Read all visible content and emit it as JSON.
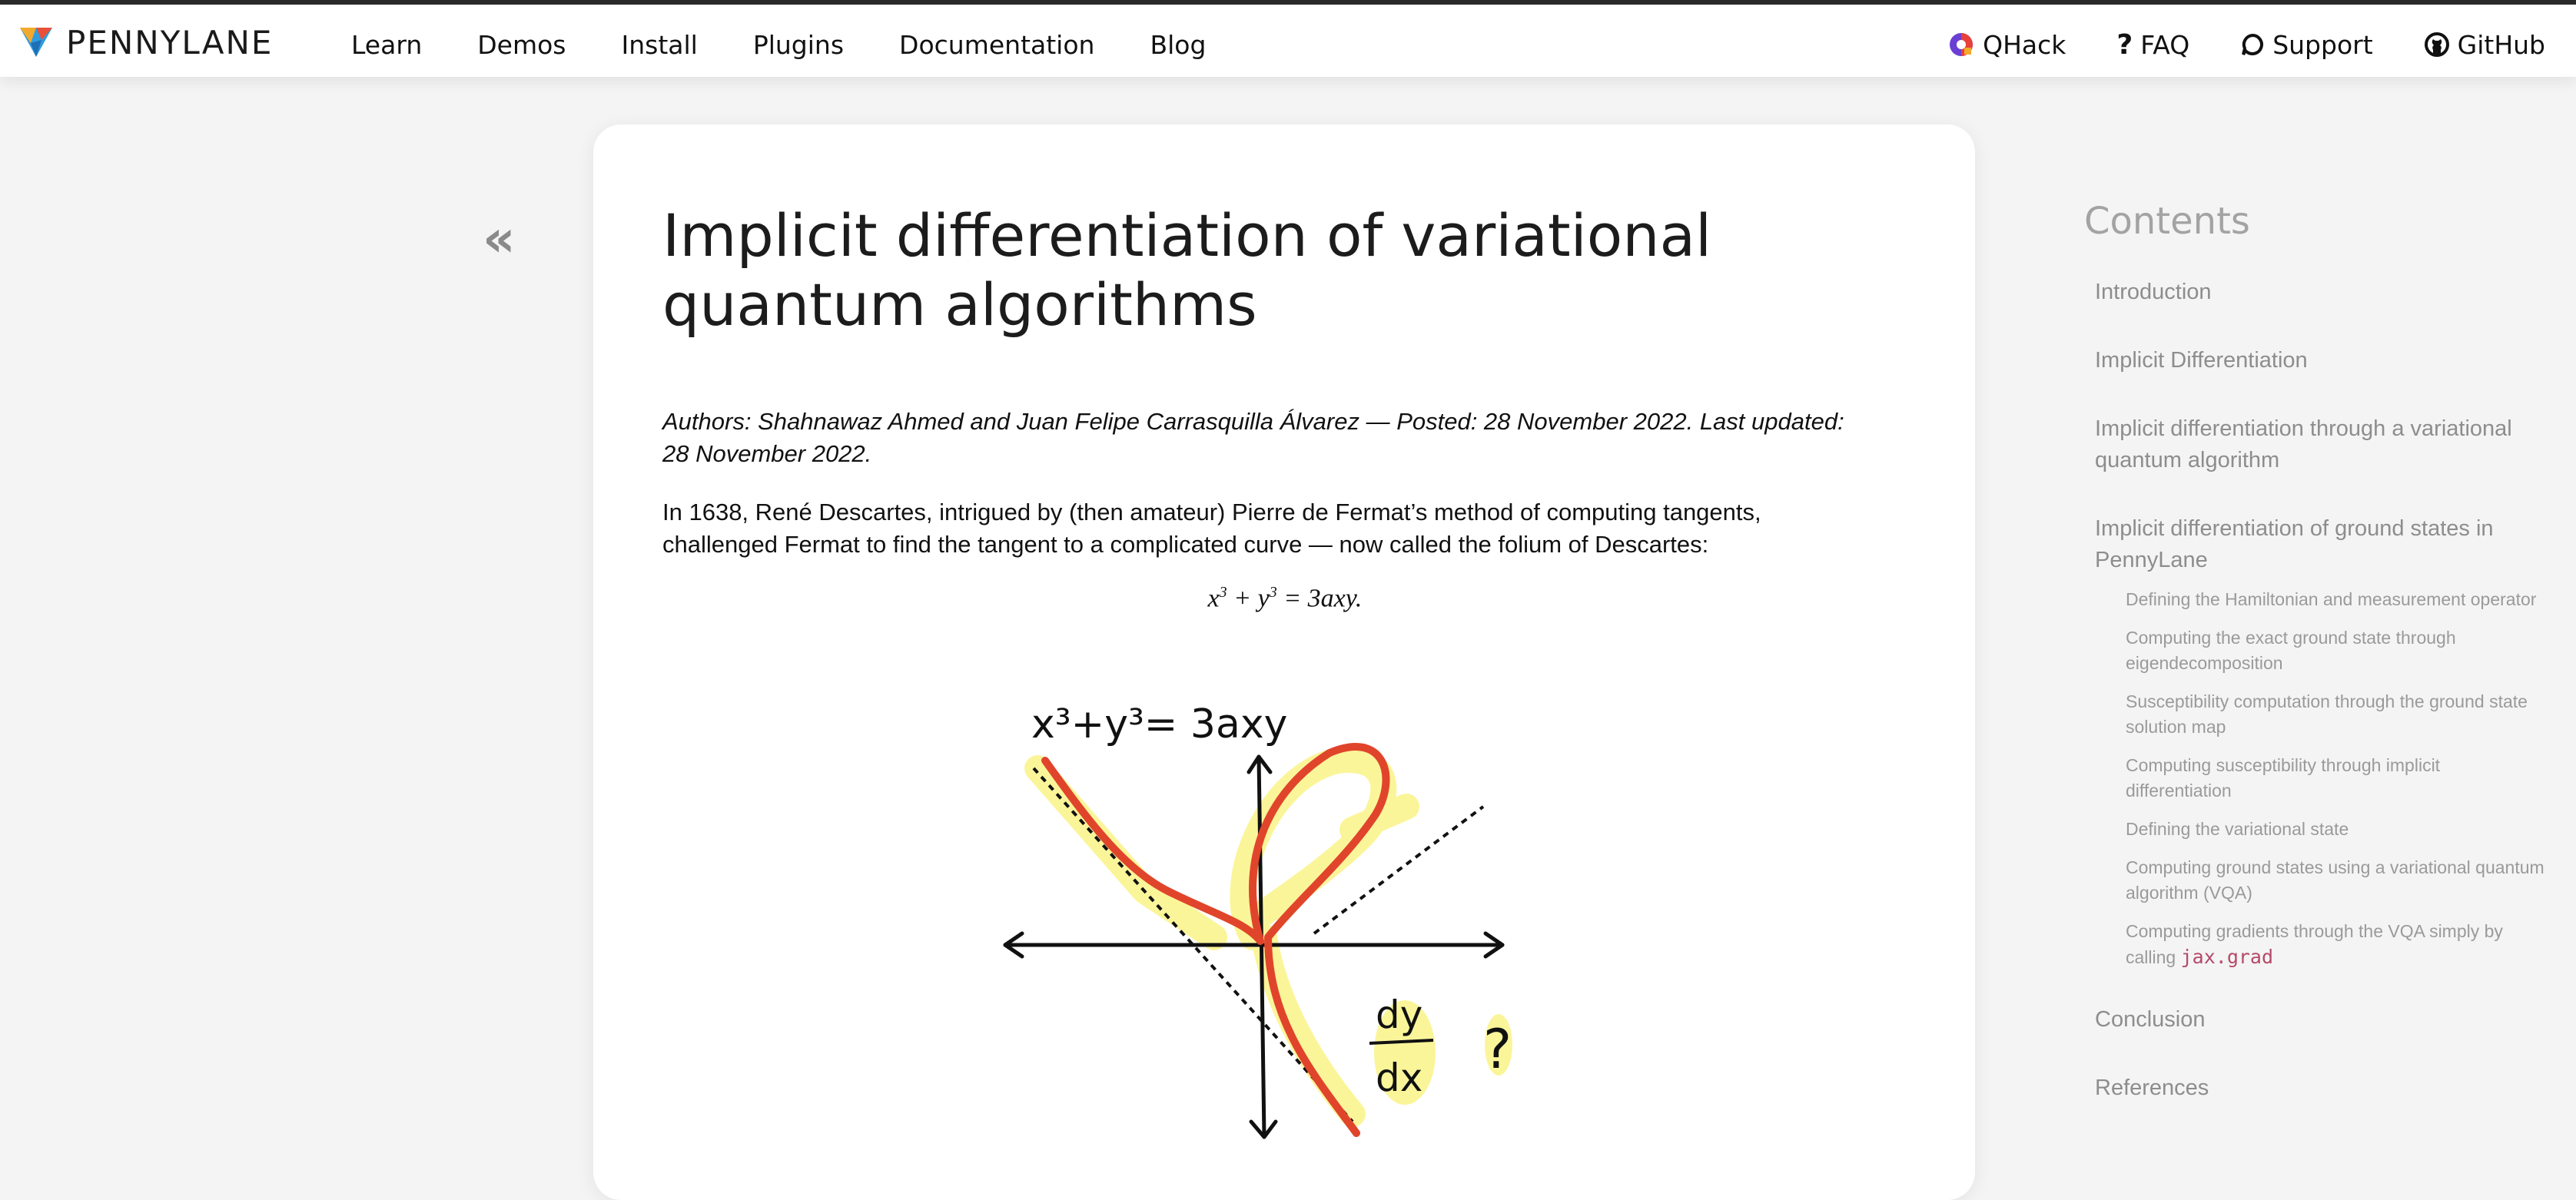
{
  "header": {
    "brand": "PENNYLANE",
    "nav": [
      "Learn",
      "Demos",
      "Install",
      "Plugins",
      "Documentation",
      "Blog"
    ],
    "right_links": [
      {
        "label": "QHack",
        "icon": "qhack-logo-icon"
      },
      {
        "label": "FAQ",
        "icon": "question-mark-icon"
      },
      {
        "label": "Support",
        "icon": "speech-bubble-icon"
      },
      {
        "label": "GitHub",
        "icon": "github-icon"
      }
    ]
  },
  "article": {
    "back_symbol": "«",
    "title": "Implicit differentiation of variational quantum algorithms",
    "authors": "Authors: Shahnawaz Ahmed and Juan Felipe Carrasquilla Álvarez — Posted: 28 November 2022. Last updated: 28 November 2022.",
    "intro": "In 1638, René Descartes, intrigued by (then amateur) Pierre de Fermat’s method of computing tangents, challenged Fermat to find the tangent to a complicated curve — now called the folium of Descartes:",
    "equation": {
      "pre": "x",
      "sup1": "3",
      "mid": " + y",
      "sup2": "3",
      "post": " = 3axy."
    },
    "figure": {
      "label": "x³+y³= 3axy",
      "num": "dy",
      "den": "dx",
      "mark": "?"
    }
  },
  "toc": {
    "title": "Contents",
    "items": [
      "Introduction",
      "Implicit Differentiation",
      "Implicit differentiation through a variational quantum algorithm",
      "Implicit differentiation of ground states in PennyLane"
    ],
    "subitems": [
      "Defining the Hamiltonian and measurement operator",
      "Computing the exact ground state through eigendecomposition",
      "Susceptibility computation through the ground state solution map",
      "Computing susceptibility through implicit differentiation",
      "Defining the variational state",
      "Computing ground states using a variational quantum algorithm (VQA)",
      "Computing gradients through the VQA simply by calling"
    ],
    "subitem_code": "jax.grad",
    "tail_items": [
      "Conclusion",
      "References"
    ]
  },
  "colors": {
    "curve": "#e0452b",
    "highlight": "#fbf59a",
    "accent_code": "#b5496a"
  }
}
